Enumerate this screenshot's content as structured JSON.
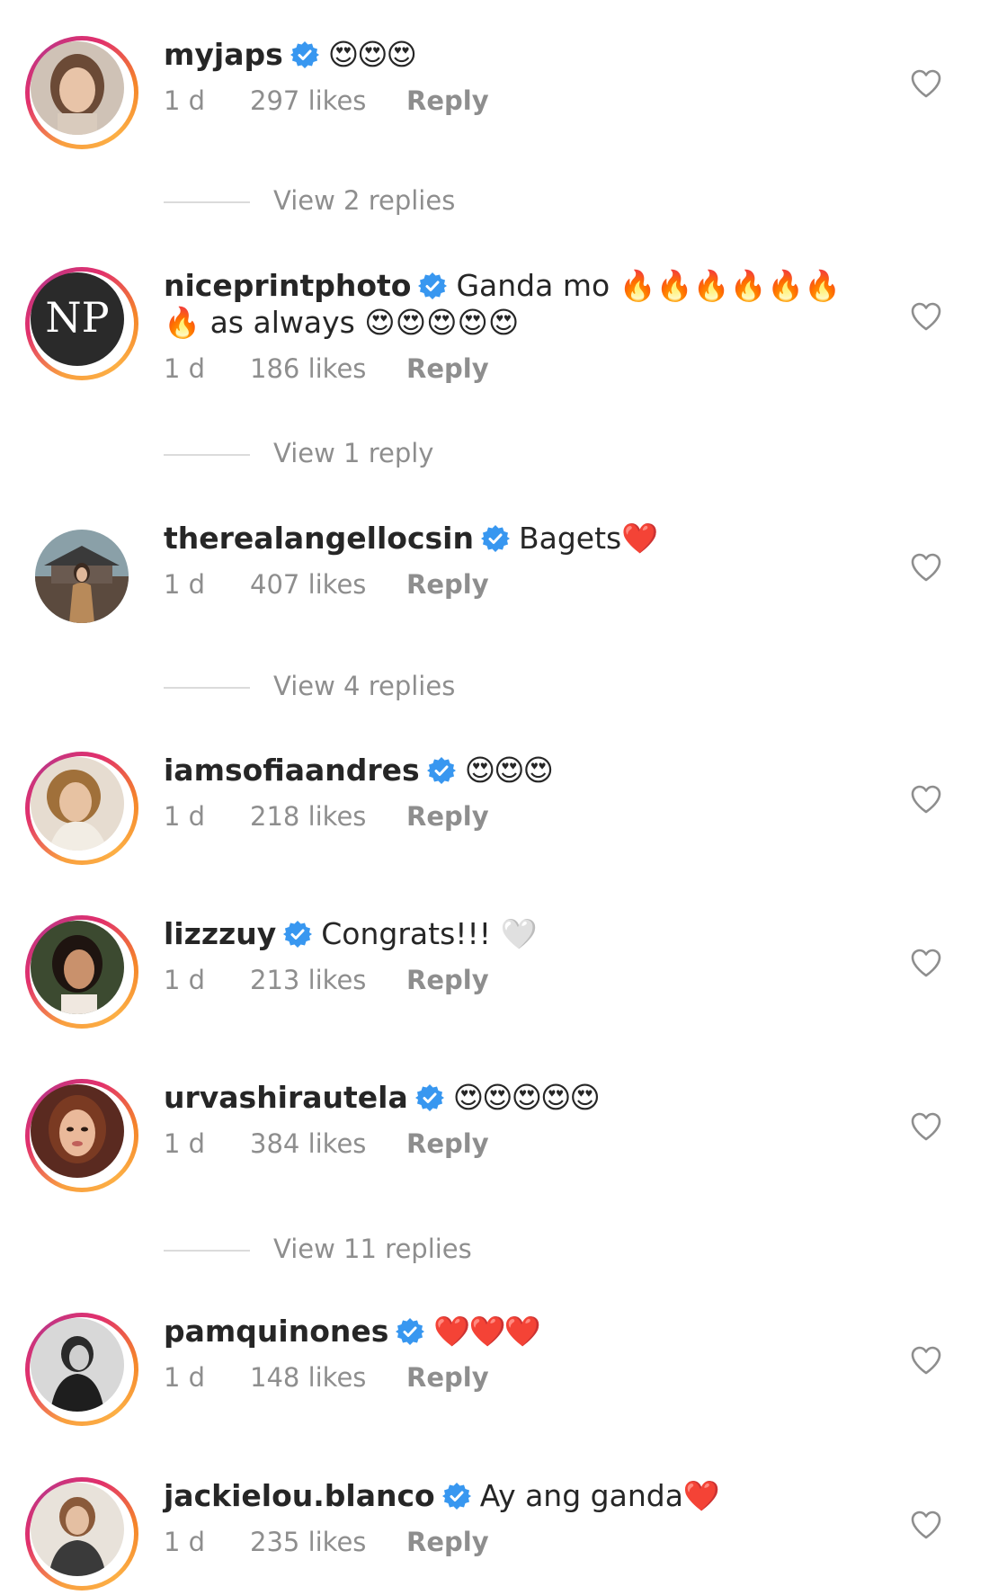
{
  "comments": [
    {
      "username": "myjaps",
      "verified": true,
      "text": "😍😍😍",
      "time": "1 d",
      "likes": "297 likes",
      "reply": "Reply",
      "view_replies": "View 2 replies",
      "avatar_ring": true
    },
    {
      "username": "niceprintphoto",
      "verified": true,
      "text": "Ganda mo 🔥🔥🔥🔥🔥🔥🔥 as always 😍😍😍😍😍",
      "time": "1 d",
      "likes": "186 likes",
      "reply": "Reply",
      "view_replies": "View 1 reply",
      "avatar_ring": true,
      "avatar_text": "NP"
    },
    {
      "username": "therealangellocsin",
      "verified": true,
      "text": "Bagets❤️",
      "time": "1 d",
      "likes": "407 likes",
      "reply": "Reply",
      "view_replies": "View 4 replies",
      "avatar_ring": false
    },
    {
      "username": "iamsofiaandres",
      "verified": true,
      "text": "😍😍😍",
      "time": "1 d",
      "likes": "218 likes",
      "reply": "Reply",
      "avatar_ring": true
    },
    {
      "username": "lizzzuy",
      "verified": true,
      "text": "Congrats!!! 🤍",
      "time": "1 d",
      "likes": "213 likes",
      "reply": "Reply",
      "avatar_ring": true
    },
    {
      "username": "urvashirautela",
      "verified": true,
      "text": "😍😍😍😍😍",
      "time": "1 d",
      "likes": "384 likes",
      "reply": "Reply",
      "view_replies": "View 11 replies",
      "avatar_ring": true
    },
    {
      "username": "pamquinones",
      "verified": true,
      "text": "❤️❤️❤️",
      "time": "1 d",
      "likes": "148 likes",
      "reply": "Reply",
      "avatar_ring": true
    },
    {
      "username": "jackielou.blanco",
      "verified": true,
      "text": "Ay ang ganda❤️",
      "time": "1 d",
      "likes": "235 likes",
      "reply": "Reply",
      "avatar_ring": true
    }
  ],
  "colors": {
    "text": "#262626",
    "secondary": "#8e8e8e",
    "verified_blue": "#3897f0",
    "divider": "#dbdbdb"
  },
  "icons": {
    "verified": "verified-badge-icon",
    "like": "heart-outline-icon"
  }
}
